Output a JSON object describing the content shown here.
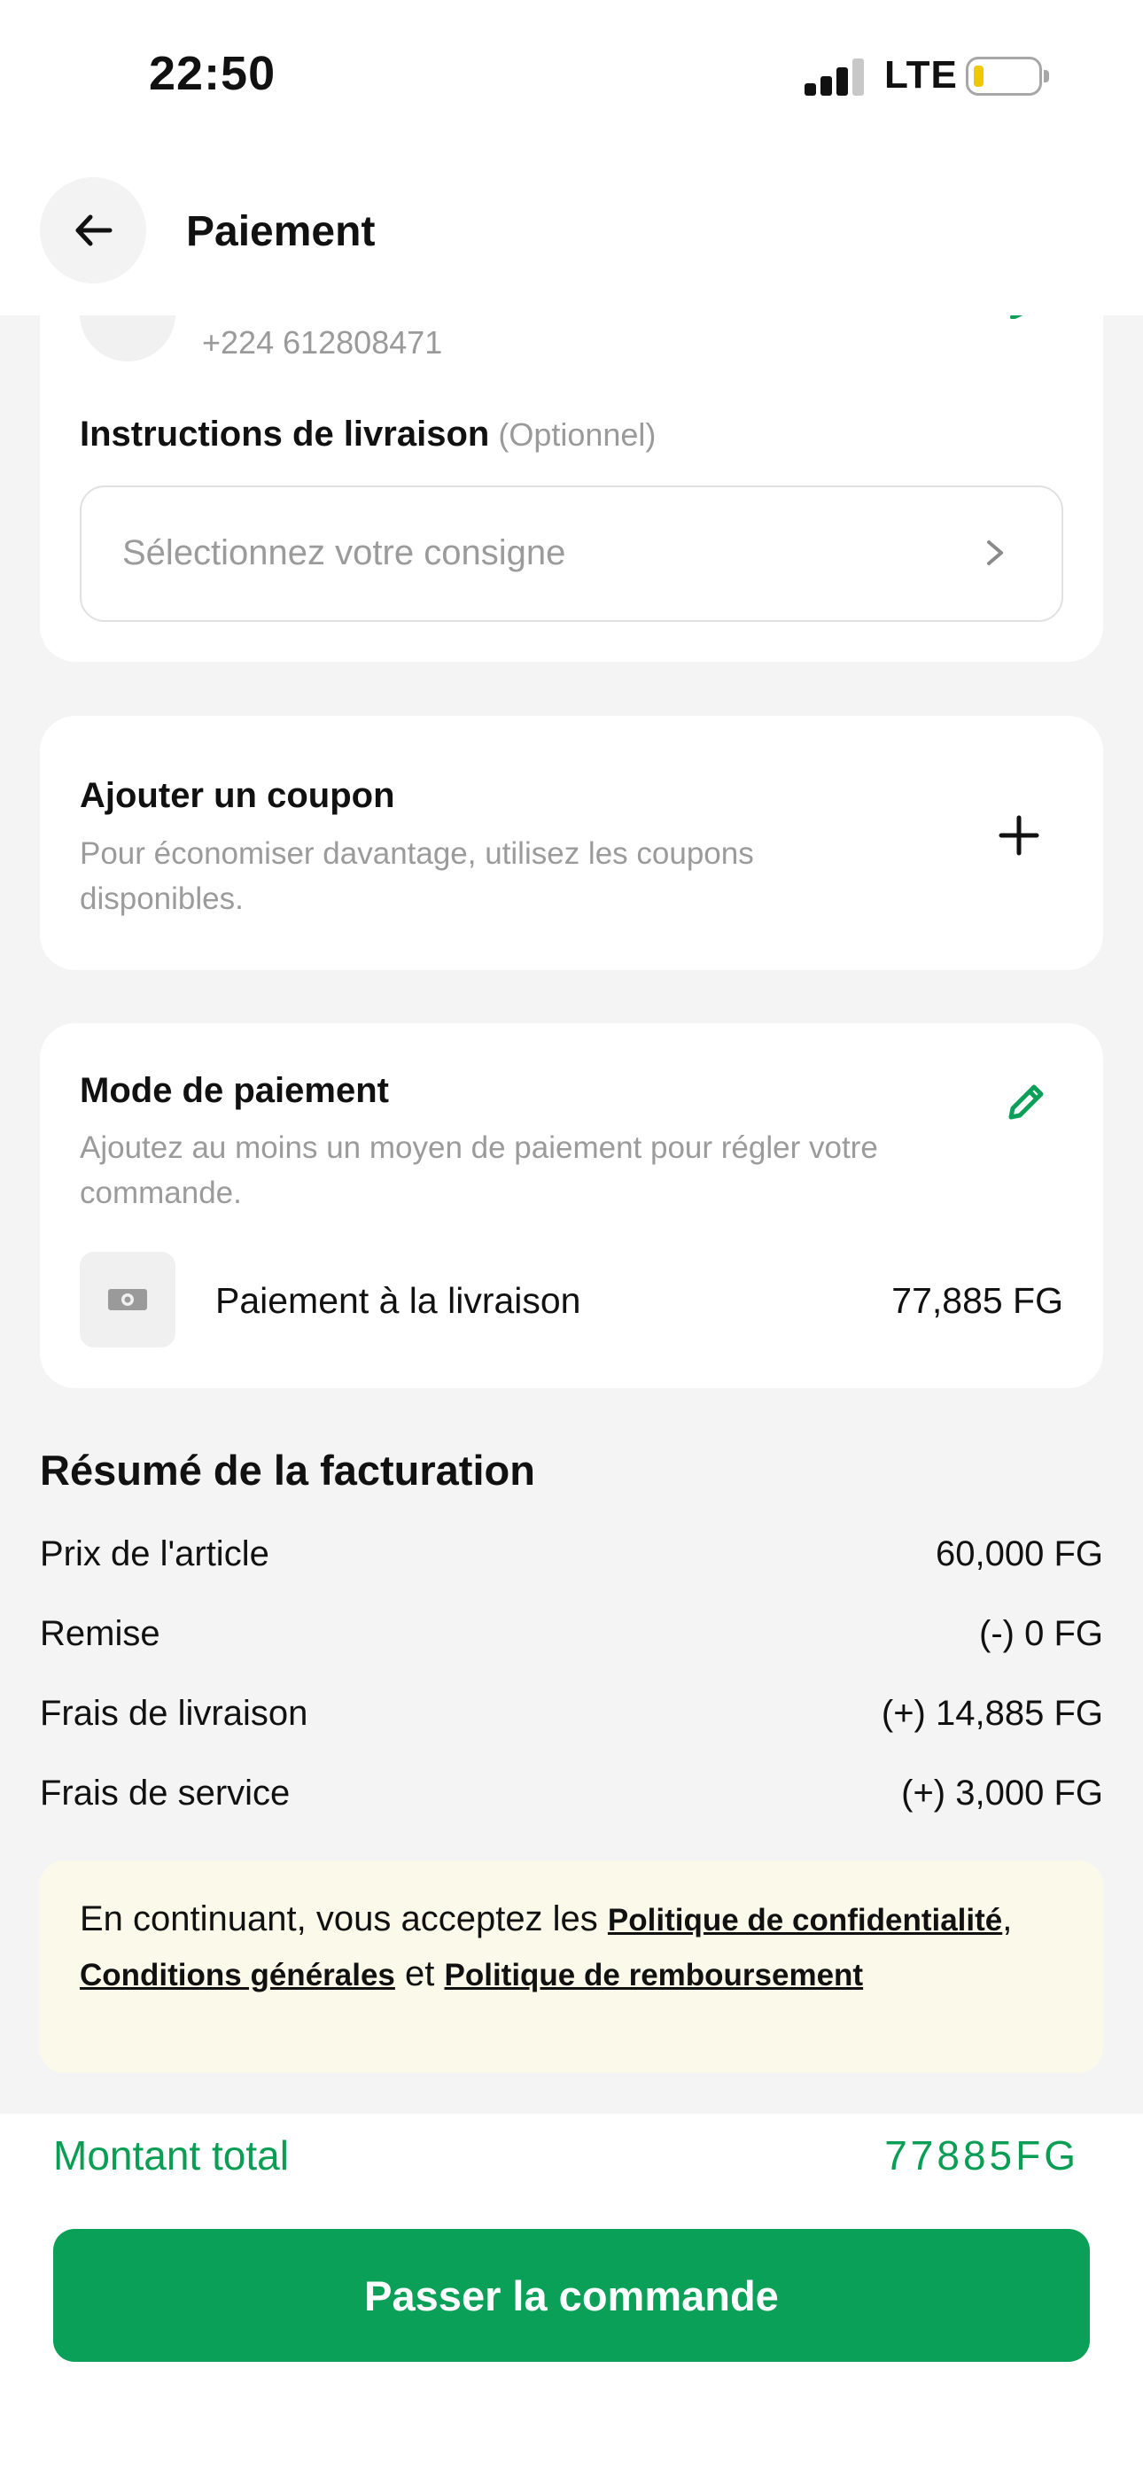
{
  "status_bar": {
    "time": "22:50",
    "network": "LTE"
  },
  "header": {
    "title": "Paiement"
  },
  "contact": {
    "phone": "+224 612808471"
  },
  "delivery_instructions": {
    "label": "Instructions de livraison",
    "optional": "(Optionnel)",
    "placeholder": "Sélectionnez votre consigne"
  },
  "coupon": {
    "title": "Ajouter un coupon",
    "description": "Pour économiser davantage, utilisez les coupons disponibles."
  },
  "payment_mode": {
    "title": "Mode de paiement",
    "description": "Ajoutez au moins un moyen de paiement pour régler votre commande.",
    "method_label": "Paiement à la livraison",
    "method_amount": "77,885 FG"
  },
  "billing": {
    "title": "Résumé de la facturation",
    "rows": [
      {
        "label": "Prix de l'article",
        "value": "60,000 FG"
      },
      {
        "label": "Remise",
        "value": "(-) 0 FG"
      },
      {
        "label": "Frais de livraison",
        "value": "(+) 14,885 FG"
      },
      {
        "label": "Frais de service",
        "value": "(+) 3,000 FG"
      }
    ]
  },
  "terms": {
    "prefix": "En continuant, vous acceptez les ",
    "privacy": "Politique de confidentialité",
    "comma": ", ",
    "conditions": "Conditions générales",
    "and": " et ",
    "refund": "Politique de remboursement"
  },
  "footer": {
    "total_label": "Montant total",
    "total_value": "77885FG",
    "order_button": "Passer la commande"
  },
  "colors": {
    "accent": "#0aa058",
    "accent_text": "#0a9d54",
    "background": "#f4f4f4",
    "terms_bg": "#fbfaea"
  },
  "icons": {
    "back": "arrow-left-icon",
    "chevron": "chevron-right-icon",
    "plus": "plus-icon",
    "edit": "pencil-icon",
    "cash": "cash-icon"
  }
}
